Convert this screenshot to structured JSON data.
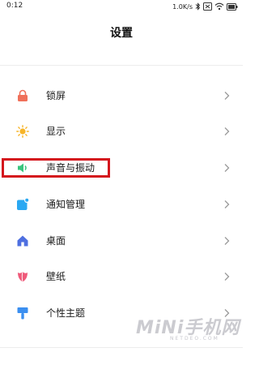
{
  "status_bar": {
    "time": "0:12",
    "net_speed": "1.0K/s"
  },
  "header": {
    "title": "设置"
  },
  "menu": {
    "items": [
      {
        "label": "锁屏",
        "icon": "lock-icon",
        "color": "#f0705a"
      },
      {
        "label": "显示",
        "icon": "sun-icon",
        "color": "#f7b529"
      },
      {
        "label": "声音与振动",
        "icon": "speaker-icon",
        "color": "#3ac47d"
      },
      {
        "label": "通知管理",
        "icon": "notification-icon",
        "color": "#2aa8f2"
      },
      {
        "label": "桌面",
        "icon": "home-icon",
        "color": "#4e6fe0"
      },
      {
        "label": "壁纸",
        "icon": "tulip-icon",
        "color": "#ef5a7a"
      },
      {
        "label": "个性主题",
        "icon": "brush-icon",
        "color": "#3b8ff0"
      }
    ]
  },
  "watermark": {
    "main": "MiNi手机网",
    "sub": "NETDEO.COM"
  }
}
